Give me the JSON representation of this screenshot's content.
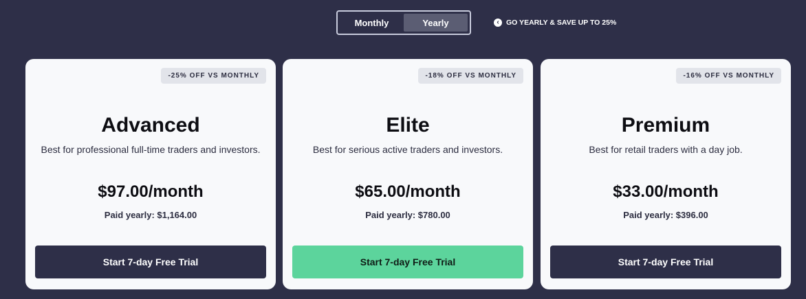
{
  "billing_toggle": {
    "options": [
      "Monthly",
      "Yearly"
    ],
    "selected": "Yearly"
  },
  "save_note": {
    "text": "GO YEARLY & SAVE UP TO 25%",
    "icon": "chevron-left-circle-icon"
  },
  "plans": [
    {
      "badge": "-25% OFF VS MONTHLY",
      "name": "Advanced",
      "description": "Best for professional full-time traders and investors.",
      "price": "$97.00/month",
      "yearly": "Paid yearly: $1,164.00",
      "cta": "Start 7-day Free Trial",
      "cta_color": "#2e2f48"
    },
    {
      "badge": "-18% OFF VS MONTHLY",
      "name": "Elite",
      "description": "Best for serious active traders and investors.",
      "price": "$65.00/month",
      "yearly": "Paid yearly: $780.00",
      "cta": "Start 7-day Free Trial",
      "cta_color": "#5cd49c"
    },
    {
      "badge": "-16% OFF VS MONTHLY",
      "name": "Premium",
      "description": "Best for retail traders with a day job.",
      "price": "$33.00/month",
      "yearly": "Paid yearly: $396.00",
      "cta": "Start 7-day Free Trial",
      "cta_color": "#2e2f48"
    }
  ],
  "colors": {
    "background": "#2e2f48",
    "card": "#f8f9fb",
    "accent_green": "#5cd49c"
  }
}
